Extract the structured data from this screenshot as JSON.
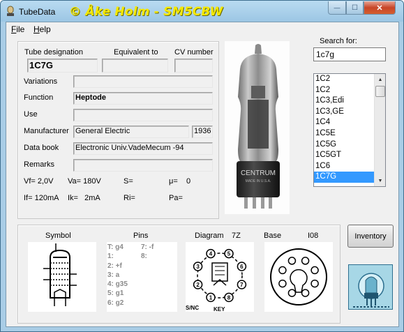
{
  "window": {
    "title": "TubeData",
    "banner": "© Åke Holm - SM5CBW",
    "minimize_glyph": "—",
    "maximize_glyph": "☐",
    "close_glyph": "✕"
  },
  "menu": {
    "items": [
      {
        "label": "File",
        "underline": "F"
      },
      {
        "label": "Help",
        "underline": "H"
      }
    ]
  },
  "details": {
    "tube_designation_label": "Tube designation",
    "equivalent_label": "Equivalent to",
    "cv_number_label": "CV number",
    "tube_designation": "1C7G",
    "equivalent": "",
    "cv_number": "",
    "variations_label": "Variations",
    "variations": "",
    "function_label": "Function",
    "function": "Heptode",
    "use_label": "Use",
    "use": "",
    "manufacturer_label": "Manufacturer",
    "manufacturer": "General Electric",
    "year": "1936",
    "data_book_label": "Data book",
    "data_book": "Electronic Univ.VadeMecum -94",
    "remarks_label": "Remarks",
    "remarks": "",
    "vf": "Vf= 2,0V",
    "va": "Va= 180V",
    "s": "S=",
    "mu": "μ=    0",
    "if": "If= 120mA",
    "ik": "Ik=   2mA",
    "ri": "Ri=",
    "pa": "Pa="
  },
  "search": {
    "label": "Search for:",
    "value": "1c7g",
    "results": [
      "1C2",
      "1C2",
      "1C3,Edi",
      "1C3,GE",
      "1C4",
      "1C5E",
      "1C5G",
      "1C5GT",
      "1C6",
      "1C7G"
    ],
    "selected_index": 9
  },
  "bottom": {
    "symbol_label": "Symbol",
    "pins_label": "Pins",
    "diagram_label": "Diagram",
    "diagram_code": "7Z",
    "base_label": "Base",
    "base_code": "I08",
    "pins_left": [
      "T: g4",
      "1:",
      "2: +f",
      "3: a",
      "4: g35",
      "5: g1",
      "6: g2"
    ],
    "pins_right": [
      "7: -f",
      "8:"
    ],
    "diagram_pins": [
      "1",
      "2",
      "3",
      "4",
      "5",
      "6",
      "7",
      "8"
    ],
    "diagram_note": "S/NC",
    "diagram_key": "KEY"
  },
  "inventory_button": "Inventory",
  "photo": {
    "brand": "CENTRUM",
    "made_in": "MADE IN U.S.A."
  },
  "colors": {
    "banner": "#f5e800",
    "selection": "#3399ff",
    "titlebar": "#a9cde6"
  }
}
